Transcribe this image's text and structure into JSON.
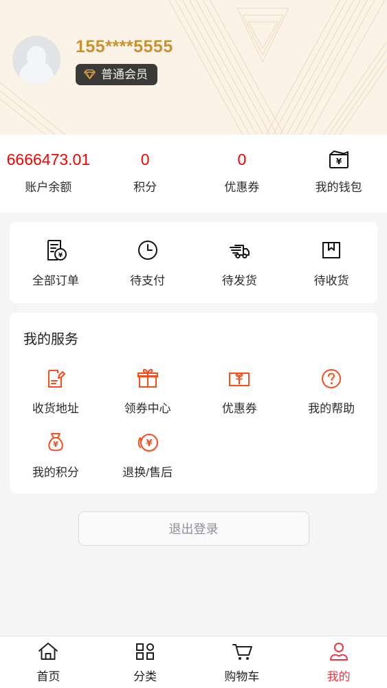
{
  "theme": {
    "header_bg": "#fbf3e7",
    "header_line": "#ecd9b8",
    "gold": "#c8932f",
    "red": "#ff0000",
    "orange": "#fc4a1a",
    "tab_active": "#f5333f",
    "page_bg": "#f5f5f5",
    "card_bg": "#ffffff"
  },
  "header": {
    "avatar_icon": "default-user-avatar-icon",
    "phone": "155****5555",
    "badge": {
      "icon": "diamond-icon",
      "label": "普通会员"
    }
  },
  "balance": {
    "items": [
      {
        "value": "6666473.01",
        "label": "账户余额",
        "icon": null
      },
      {
        "value": "0",
        "label": "积分",
        "icon": null
      },
      {
        "value": "0",
        "label": "优惠券",
        "icon": null
      },
      {
        "value": null,
        "label": "我的钱包",
        "icon": "wallet-icon"
      }
    ]
  },
  "orders": {
    "items": [
      {
        "label": "全部订单",
        "icon": "order-document-yen-icon"
      },
      {
        "label": "待支付",
        "icon": "clock-icon"
      },
      {
        "label": "待发货",
        "icon": "truck-icon"
      },
      {
        "label": "待收货",
        "icon": "package-box-icon"
      }
    ]
  },
  "services": {
    "title": "我的服务",
    "items": [
      {
        "label": "收货地址",
        "icon": "address-edit-icon"
      },
      {
        "label": "领券中心",
        "icon": "gift-icon"
      },
      {
        "label": "优惠券",
        "icon": "coupon-ticket-icon"
      },
      {
        "label": "我的帮助",
        "icon": "question-circle-icon"
      },
      {
        "label": "我的积分",
        "icon": "money-bag-yen-icon"
      },
      {
        "label": "退换/售后",
        "icon": "refund-yen-icon"
      }
    ]
  },
  "logout": {
    "label": "退出登录"
  },
  "tabbar": {
    "items": [
      {
        "label": "首页",
        "icon": "home-icon",
        "active": false
      },
      {
        "label": "分类",
        "icon": "grid-category-icon",
        "active": false
      },
      {
        "label": "购物车",
        "icon": "shopping-cart-icon",
        "active": false
      },
      {
        "label": "我的",
        "icon": "user-profile-icon",
        "active": true
      }
    ]
  }
}
